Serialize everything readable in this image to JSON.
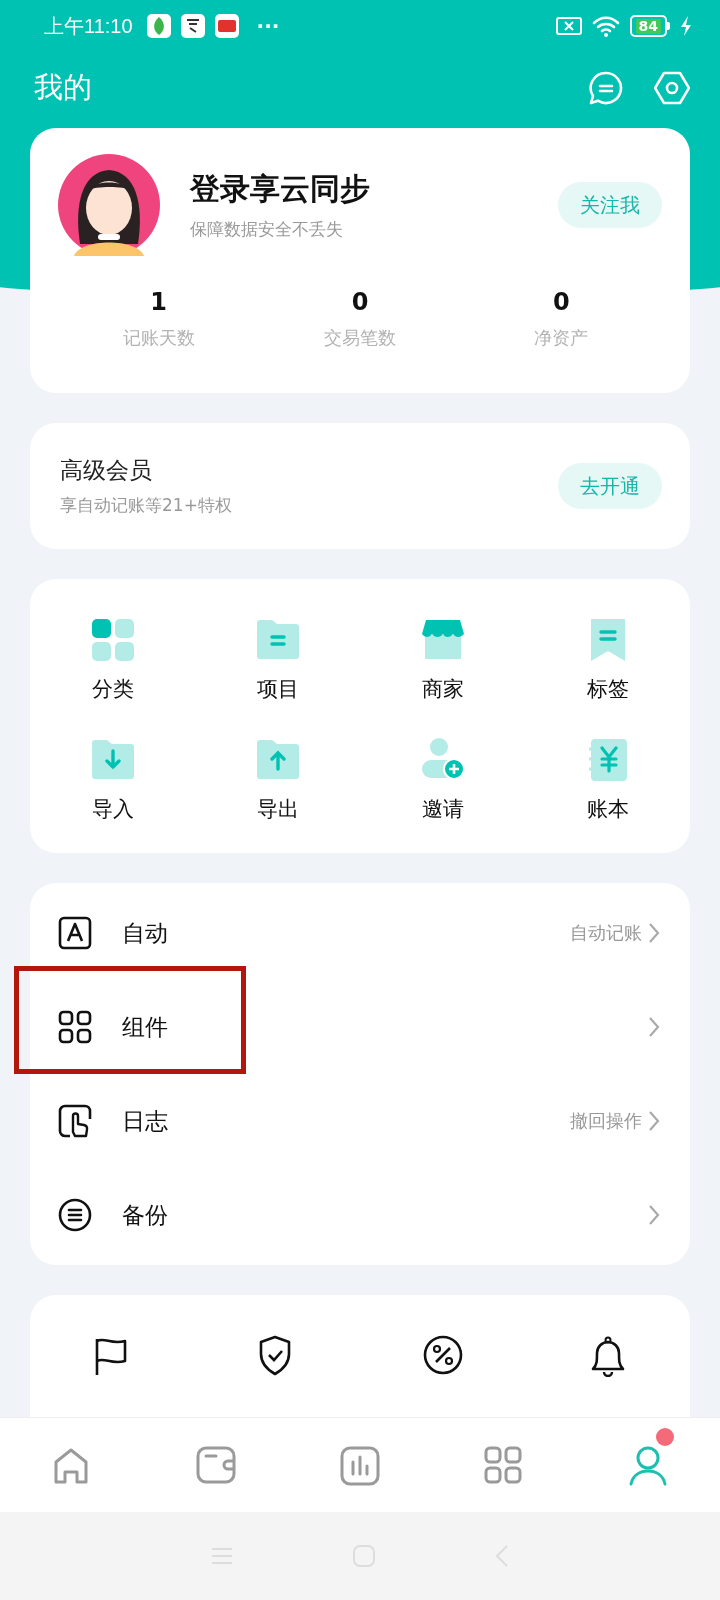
{
  "status_bar": {
    "time": "上午11:10",
    "more": "···",
    "battery": "84"
  },
  "header": {
    "title": "我的"
  },
  "profile": {
    "name": "登录享云同步",
    "subtitle": "保障数据安全不丢失",
    "follow_button": "关注我",
    "stats": [
      {
        "value": "1",
        "label": "记账天数"
      },
      {
        "value": "0",
        "label": "交易笔数"
      },
      {
        "value": "0",
        "label": "净资产"
      }
    ]
  },
  "membership": {
    "title": "高级会员",
    "subtitle": "享自动记账等21+特权",
    "button": "去开通"
  },
  "shortcuts": [
    {
      "label": "分类"
    },
    {
      "label": "项目"
    },
    {
      "label": "商家"
    },
    {
      "label": "标签"
    },
    {
      "label": "导入"
    },
    {
      "label": "导出"
    },
    {
      "label": "邀请"
    },
    {
      "label": "账本"
    }
  ],
  "menu": [
    {
      "label": "自动",
      "detail": "自动记账",
      "highlighted": false
    },
    {
      "label": "组件",
      "highlighted": true
    },
    {
      "label": "日志",
      "detail": "撤回操作",
      "highlighted": false
    },
    {
      "label": "备份",
      "highlighted": false
    }
  ],
  "nav": [
    {
      "selected": false,
      "badge": false
    },
    {
      "selected": false,
      "badge": false
    },
    {
      "selected": false,
      "badge": false
    },
    {
      "selected": false,
      "badge": false
    },
    {
      "selected": true,
      "badge": true
    }
  ]
}
